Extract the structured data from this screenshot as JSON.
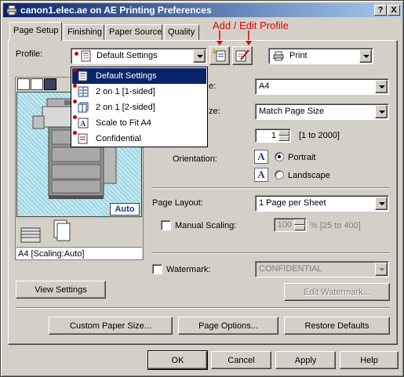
{
  "window": {
    "title": "canon1.elec.ae on AE Printing Preferences",
    "help_btn": "?",
    "close_btn": "X"
  },
  "annotation": {
    "text": "Add / Edit Profile",
    "color": "#e00000"
  },
  "tabs": [
    {
      "label": "Page Setup",
      "active": true
    },
    {
      "label": "Finishing"
    },
    {
      "label": "Paper Source"
    },
    {
      "label": "Quality"
    }
  ],
  "profile": {
    "label": "Profile:",
    "value": "Default Settings",
    "options": [
      "Default Settings",
      "2 on 1 [1-sided]",
      "2 on 1 [2-sided]",
      "Scale to Fit A4",
      "Confidential"
    ],
    "selected_index": 0
  },
  "output": {
    "value": "Print"
  },
  "preview": {
    "badge": "Auto",
    "caption": "A4 [Scaling:Auto]",
    "view_settings": "View Settings"
  },
  "page_size": {
    "label_tail": "e:",
    "value": "A4"
  },
  "output_size": {
    "label_tail": "ze:",
    "value": "Match Page Size"
  },
  "copies": {
    "value": "1",
    "range": "[1 to 2000]"
  },
  "orientation": {
    "label": "Orientation:",
    "portrait": "Portrait",
    "landscape": "Landscape",
    "selected": "Portrait"
  },
  "page_layout": {
    "label": "Page Layout:",
    "value": "1 Page per Sheet"
  },
  "manual_scaling": {
    "label": "Manual Scaling:",
    "value": "100",
    "unit_range": "% [25 to 400]",
    "checked": false
  },
  "watermark": {
    "label": "Watermark:",
    "value": "CONFIDENTIAL",
    "edit_btn": "Edit Watermark...",
    "checked": false
  },
  "buttons": {
    "custom_paper": "Custom Paper Size...",
    "page_options": "Page Options...",
    "restore": "Restore Defaults"
  },
  "footer": {
    "ok": "OK",
    "cancel": "Cancel",
    "apply": "Apply",
    "help": "Help"
  }
}
